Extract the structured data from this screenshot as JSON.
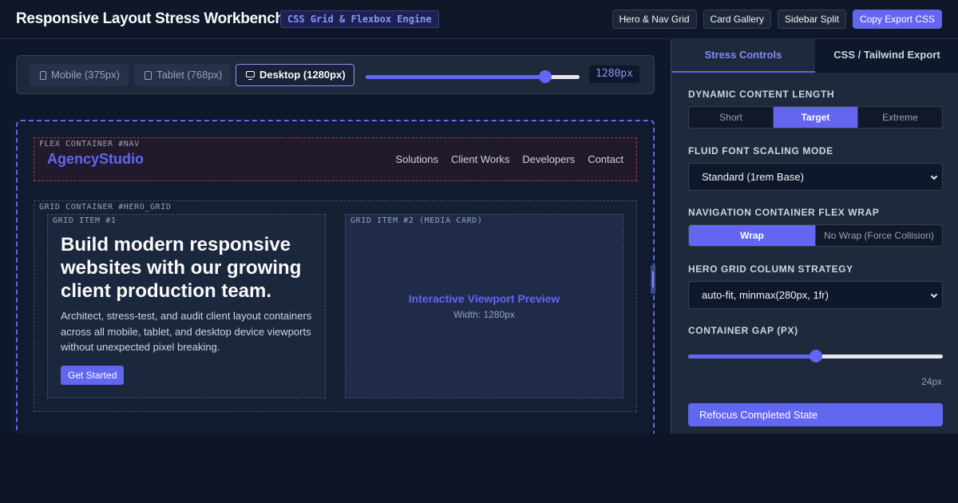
{
  "header": {
    "title": "Responsive Layout Stress Workbench",
    "badge": "CSS Grid & Flexbox Engine",
    "actions": [
      "Hero & Nav Grid",
      "Card Gallery",
      "Sidebar Split",
      "Copy Export CSS"
    ]
  },
  "viewport": {
    "options": [
      {
        "label": "Mobile (375px)",
        "icon": "phone-icon"
      },
      {
        "label": "Tablet (768px)",
        "icon": "tablet-icon"
      },
      {
        "label": "Desktop (1280px)",
        "icon": "desktop-icon"
      }
    ],
    "active": "Desktop (1280px)",
    "width_fraction": 0.84,
    "readout": "1280px"
  },
  "preview": {
    "nav_label": "FLEX CONTAINER #NAV",
    "brand": "AgencyStudio",
    "nav_links": [
      "Solutions",
      "Client Works",
      "Developers",
      "Contact"
    ],
    "hero_label": "GRID CONTAINER #HERO_GRID",
    "item1_label": "GRID ITEM #1",
    "hero_title": "Build modern responsive websites with our growing client production team.",
    "hero_body": "Architect, stress-test, and audit client layout containers across all mobile, tablet, and desktop device viewports without unexpected pixel breaking.",
    "cta": "Get Started",
    "item2_label": "GRID ITEM #2 (MEDIA CARD)",
    "media_title": "Interactive Viewport Preview",
    "media_width": "Width: 1280px"
  },
  "panel": {
    "tabs": [
      "Stress Controls",
      "CSS / Tailwind Export"
    ],
    "active_tab": "Stress Controls",
    "content_length": {
      "label": "DYNAMIC CONTENT LENGTH",
      "options": [
        "Short",
        "Target",
        "Extreme"
      ],
      "selected": "Target"
    },
    "font_scaling": {
      "label": "FLUID FONT SCALING MODE",
      "value": "Standard (1rem Base)"
    },
    "flex_wrap": {
      "label": "NAVIGATION CONTAINER FLEX WRAP",
      "options": [
        "Wrap",
        "No Wrap (Force Collision)"
      ],
      "selected": "Wrap"
    },
    "grid_strategy": {
      "label": "HERO GRID COLUMN STRATEGY",
      "value": "auto-fit, minmax(280px, 1fr)"
    },
    "gap": {
      "label": "CONTAINER GAP (PX)",
      "value_text": "24px",
      "fraction": 0.5
    },
    "refocus": "Refocus Completed State"
  },
  "colors": {
    "accent": "#6366f1",
    "background": "#0f172a",
    "panel": "#1e293b",
    "nav_border": "#9f3a54"
  }
}
